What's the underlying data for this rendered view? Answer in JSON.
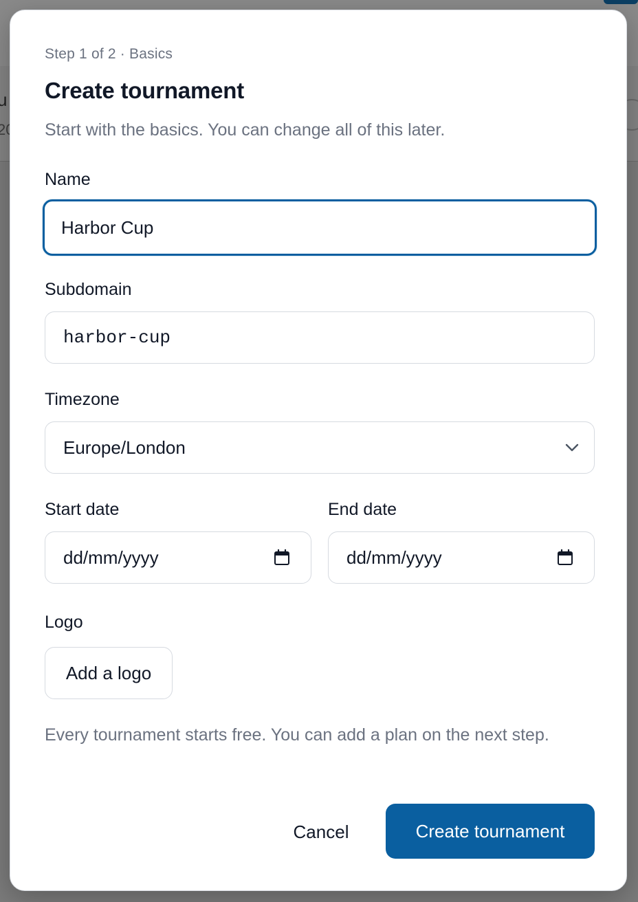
{
  "background": {
    "fragment_top": "u",
    "fragment_bottom": "20"
  },
  "dialog": {
    "step": "Step 1 of 2 · Basics",
    "title": "Create tournament",
    "subtitle": "Start with the basics. You can change all of this later.",
    "name": {
      "label": "Name",
      "value": "Harbor Cup"
    },
    "subdomain": {
      "label": "Subdomain",
      "value": "harbor-cup"
    },
    "timezone": {
      "label": "Timezone",
      "value": "Europe/London"
    },
    "start_date": {
      "label": "Start date",
      "placeholder": "dd/mm/yyyy"
    },
    "end_date": {
      "label": "End date",
      "placeholder": "dd/mm/yyyy"
    },
    "logo": {
      "label": "Logo",
      "button": "Add a logo"
    },
    "note": "Every tournament starts free. You can add a plan on the next step.",
    "cancel": "Cancel",
    "submit": "Create tournament"
  },
  "icons": {
    "timezone": "chevron-down-icon",
    "date": "calendar-icon"
  },
  "colors": {
    "primary": "#0a5fa0",
    "muted_text": "#6b7280",
    "text": "#111827",
    "border": "#d6dae0",
    "overlay": "#7b7b7b"
  }
}
